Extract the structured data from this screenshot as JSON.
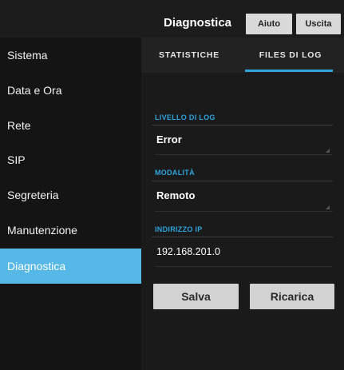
{
  "header": {
    "title": "Diagnostica",
    "help_label": "Aiuto",
    "exit_label": "Uscita"
  },
  "sidebar": {
    "items": [
      {
        "label": "Sistema",
        "active": false
      },
      {
        "label": "Data e Ora",
        "active": false
      },
      {
        "label": "Rete",
        "active": false
      },
      {
        "label": "SIP",
        "active": false
      },
      {
        "label": "Segreteria",
        "active": false
      },
      {
        "label": "Manutenzione",
        "active": false
      },
      {
        "label": "Diagnostica",
        "active": true
      }
    ]
  },
  "tabs": [
    {
      "label": "STATISTICHE",
      "active": false
    },
    {
      "label": "FILES DI LOG",
      "active": true
    }
  ],
  "form": {
    "log_level": {
      "label": "LIVELLO DI LOG",
      "value": "Error"
    },
    "mode": {
      "label": "MODALITÀ",
      "value": "Remoto"
    },
    "ip": {
      "label": "INDIRIZZO IP",
      "value": "192.168.201.0"
    }
  },
  "actions": {
    "save_label": "Salva",
    "reload_label": "Ricarica"
  },
  "colors": {
    "accent": "#2ea3dc",
    "active_sidebar": "#55b8e6",
    "button_bg": "#d2d2d2"
  }
}
